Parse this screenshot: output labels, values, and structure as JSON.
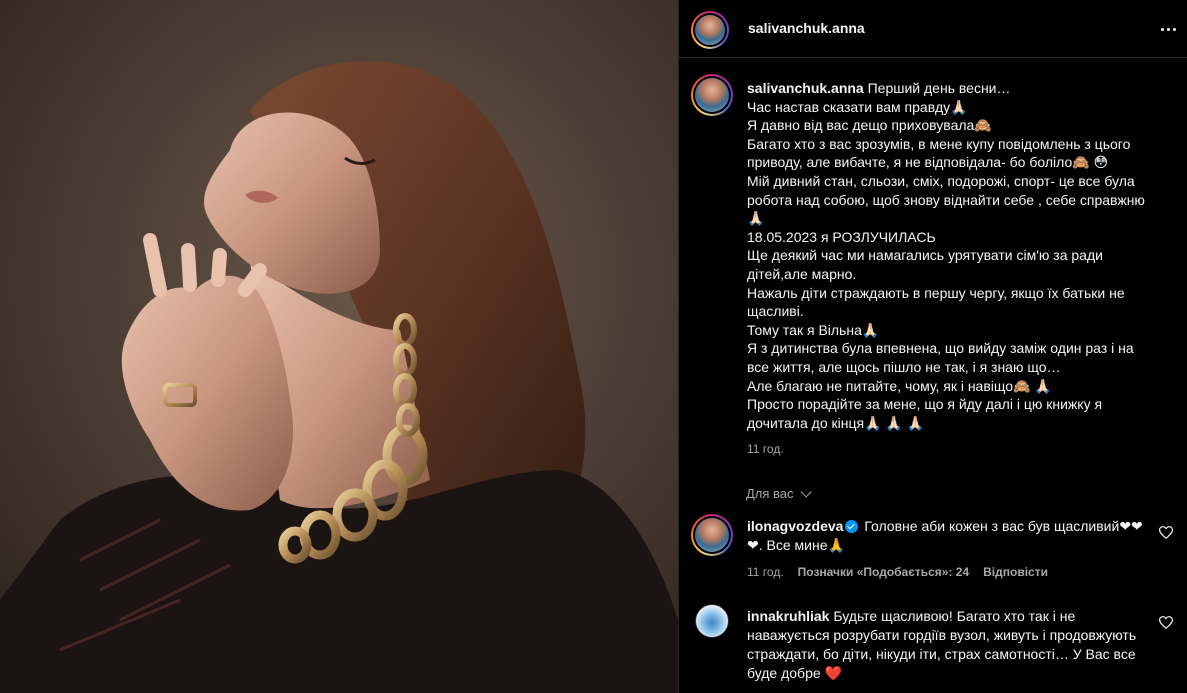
{
  "post": {
    "username": "salivanchuk.anna",
    "caption_lines": [
      "Перший день весни…",
      "Час настав сказати вам правду🙏🏻",
      "Я давно від вас дещо приховувала🙈",
      "Багато хто з вас зрозумів, в мене купу повідомлень з цього",
      "приводу, але вибачте, я не відповідала- бо боліло🙈 😳",
      "Мій дивний стан, сльози, сміх, подорожі, спорт- це все була",
      "робота над собою, щоб знову віднайти себе , себе справжню",
      "🙏🏻",
      "18.05.2023 я РОЗЛУЧИЛАСЬ",
      "Ще деякий час ми намагались урятувати сім'ю за ради",
      "дітей,але марно.",
      "Нажаль діти страждають в першу чергу, якщо їх батьки не",
      "щасливі.",
      "Тому так я Вільна🙏🏻",
      "Я з дитинства була впевнена, що вийду заміж один раз і на",
      "все життя, але щось пішло не так, і я знаю що…",
      "Але благаю не питайте, чому, як і навіщо🙈 🙏🏻",
      "Просто порадійте за мене, що я йду далі і цю книжку я",
      "дочитала до кінця🙏🏻 🙏🏻 🙏🏻"
    ],
    "time": "11 год."
  },
  "comments_filter": "Для вас",
  "comments": [
    {
      "username": "ilonagvozdeva",
      "verified": true,
      "text_line1": "Головне аби кожен з вас був щасливий❤❤",
      "text_line2": "❤. Все мине🙏",
      "time": "11 год.",
      "likes": "Позначки «Подобається»: 24",
      "reply": "Відповісти"
    },
    {
      "username": "innakruhliak",
      "verified": false,
      "text_line1": "Будьте щасливою! Багато хто так і не",
      "text_line2": "наважується розрубати гордіїв вузол, живуть і продовжують",
      "text_line3": "страждати, бо діти, нікуди іти, страх самотності… У Вас все",
      "text_line4": "буде добре ❤️"
    }
  ],
  "icons": {
    "more": "more-horizontal-icon",
    "like": "heart-icon",
    "filter": "chevron-down-icon"
  },
  "colors": {
    "background": "#000000",
    "text": "#f5f5f5",
    "muted": "#a8a8a8",
    "verified": "#0095f6",
    "red_heart": "#ff3040"
  }
}
